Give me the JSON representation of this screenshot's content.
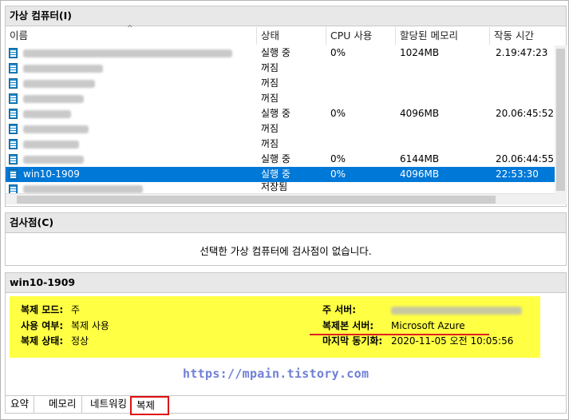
{
  "vm_panel": {
    "title": "가상 컴퓨터(I)",
    "columns": [
      "이름",
      "상태",
      "CPU 사용",
      "할당된 메모리",
      "작동 시간"
    ],
    "rows": [
      {
        "name": "",
        "state": "실행 중",
        "cpu": "0%",
        "memory": "1024MB",
        "uptime": "2.19:47:23"
      },
      {
        "name": "",
        "state": "꺼짐",
        "cpu": "",
        "memory": "",
        "uptime": ""
      },
      {
        "name": "",
        "state": "꺼짐",
        "cpu": "",
        "memory": "",
        "uptime": ""
      },
      {
        "name": "",
        "state": "꺼짐",
        "cpu": "",
        "memory": "",
        "uptime": ""
      },
      {
        "name": "",
        "state": "실행 중",
        "cpu": "0%",
        "memory": "4096MB",
        "uptime": "20.06:45:52"
      },
      {
        "name": "",
        "state": "꺼짐",
        "cpu": "",
        "memory": "",
        "uptime": ""
      },
      {
        "name": "",
        "state": "꺼짐",
        "cpu": "",
        "memory": "",
        "uptime": ""
      },
      {
        "name": "",
        "state": "실행 중",
        "cpu": "0%",
        "memory": "6144MB",
        "uptime": "20.06:44:55"
      },
      {
        "name": "win10-1909",
        "state": "실행 중",
        "cpu": "0%",
        "memory": "4096MB",
        "uptime": "22:53:30"
      },
      {
        "name": "",
        "state": "저장됨",
        "cpu": "",
        "memory": "",
        "uptime": ""
      }
    ],
    "selected_index": 8
  },
  "checkpoint_panel": {
    "title": "검사점(C)",
    "empty_message": "선택한 가상 컴퓨터에 검사점이 없습니다."
  },
  "details_panel": {
    "title": "win10-1909",
    "left": [
      {
        "label": "복제 모드:",
        "value": "주"
      },
      {
        "label": "사용 여부:",
        "value": "복제 사용"
      },
      {
        "label": "복제 상태:",
        "value": "정상"
      }
    ],
    "right": [
      {
        "label": "주 서버:",
        "value": ""
      },
      {
        "label": "복제본 서버:",
        "value": "Microsoft Azure"
      },
      {
        "label": "마지막 동기화:",
        "value": "2020-11-05 오전 10:05:56"
      }
    ],
    "watermark": "https://mpain.tistory.com",
    "tabs": [
      "요약",
      "메모리",
      "네트워킹",
      "복제"
    ],
    "active_tab": "복제"
  },
  "colors": {
    "selection": "#0078d7",
    "highlight": "#ffff44",
    "underline": "#e02020",
    "watermark": "#6f7fd6"
  }
}
